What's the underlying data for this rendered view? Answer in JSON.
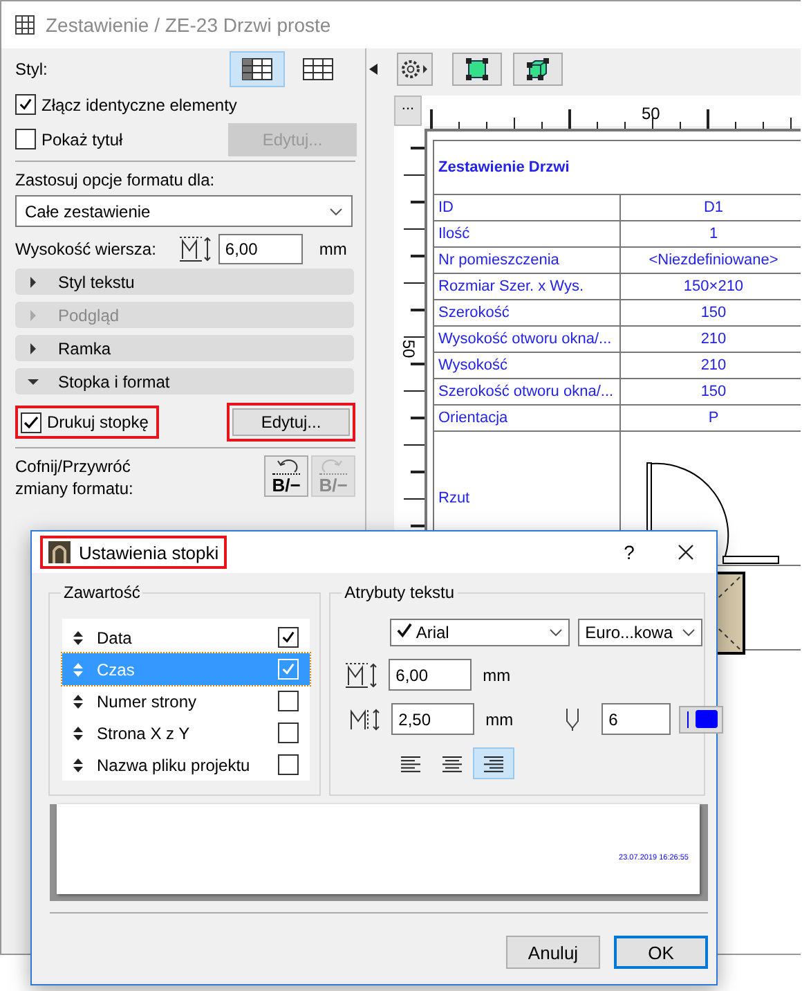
{
  "window": {
    "title": "Zestawienie / ZE-23 Drzwi proste"
  },
  "settings": {
    "style_label": "Styl:",
    "style_options": [
      {
        "selected": true
      },
      {
        "selected": false
      }
    ],
    "merge": {
      "label": "Złącz identyczne elementy",
      "checked": true
    },
    "show_title": {
      "label": "Pokaż tytuł",
      "checked": false
    },
    "show_title_button": {
      "label": "Edytuj...",
      "disabled": true
    },
    "apply_label": "Zastosuj opcje formatu dla:",
    "apply_select": {
      "value": "Całe zestawienie"
    },
    "row_height": {
      "label": "Wysokość wiersza:",
      "value": "6,00",
      "unit": "mm"
    },
    "sections": [
      {
        "label": "Styl tekstu",
        "expanded": false,
        "disabled": false
      },
      {
        "label": "Podgląd",
        "expanded": false,
        "disabled": true
      },
      {
        "label": "Ramka",
        "expanded": false,
        "disabled": false
      },
      {
        "label": "Stopka i format",
        "expanded": true,
        "disabled": false
      }
    ],
    "print_footer": {
      "label": "Drukuj stopkę",
      "checked": true,
      "highlighted": true
    },
    "footer_button": {
      "label": "Edytuj...",
      "disabled": false,
      "highlighted": true
    },
    "undo_label": "Cofnij/Przywróć zmiany formatu:",
    "undo_buttons": [
      {
        "label": "B/−",
        "disabled": false
      },
      {
        "label": "B/−",
        "disabled": true
      }
    ]
  },
  "preview": {
    "more_button": "...",
    "ruler_top_label": "50",
    "ruler_left_label": "50",
    "table": {
      "title": "Zestawienie Drzwi",
      "rows": [
        {
          "label": "ID",
          "value": "D1"
        },
        {
          "label": "Ilość",
          "value": "1"
        },
        {
          "label": "Nr pomieszczenia",
          "value": "<Niezdefiniowane>"
        },
        {
          "label": "Rozmiar Szer. x Wys.",
          "value": "150×210"
        },
        {
          "label": "Szerokość",
          "value": "150"
        },
        {
          "label": "Wysokość otworu okna/...",
          "value": "210"
        },
        {
          "label": "Wysokość",
          "value": "210"
        },
        {
          "label": "Szerokość otworu okna/...",
          "value": "150"
        },
        {
          "label": "Orientacja",
          "value": "P"
        }
      ],
      "plan_label": "Rzut"
    }
  },
  "dialog": {
    "title": "Ustawienia stopki",
    "title_highlighted": true,
    "help": "?",
    "content_group": "Zawartość",
    "items": [
      {
        "label": "Data",
        "checked": true,
        "selected": false
      },
      {
        "label": "Czas",
        "checked": true,
        "selected": true
      },
      {
        "label": "Numer strony",
        "checked": false,
        "selected": false
      },
      {
        "label": "Strona X z Y",
        "checked": false,
        "selected": false
      },
      {
        "label": "Nazwa pliku projektu",
        "checked": false,
        "selected": false
      }
    ],
    "text_group": "Atrybuty tekstu",
    "font": {
      "value": "Arial"
    },
    "charset": {
      "value": "Euro...kowa"
    },
    "text_height": {
      "value": "6,00",
      "unit": "mm"
    },
    "text_width": {
      "value": "2,50",
      "unit": "mm"
    },
    "pen": {
      "value": "6",
      "color": "#0000ff"
    },
    "alignments": [
      {
        "selected": false
      },
      {
        "selected": false
      },
      {
        "selected": true
      }
    ],
    "preview_text": "23.07.2019 16:26:55",
    "buttons": [
      {
        "label": "Anuluj",
        "default": false
      },
      {
        "label": "OK",
        "default": true
      }
    ]
  }
}
